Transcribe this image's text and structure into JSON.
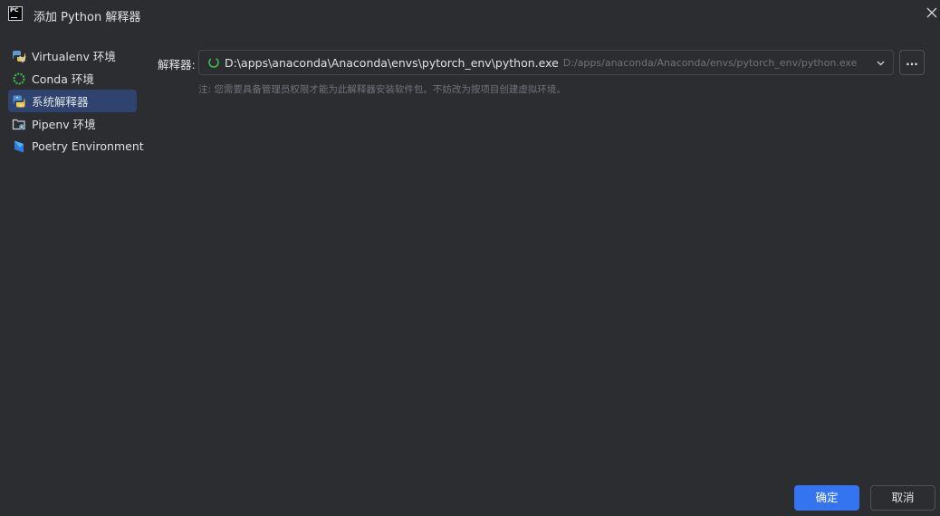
{
  "window": {
    "title": "添加 Python 解释器",
    "icon": "pycharm-icon",
    "app_icon_text": "PC"
  },
  "sidebar": {
    "items": [
      {
        "label": "Virtualenv 环境",
        "icon": "virtualenv-icon",
        "selected": false
      },
      {
        "label": "Conda 环境",
        "icon": "conda-icon",
        "selected": false
      },
      {
        "label": "系统解释器",
        "icon": "python-icon",
        "selected": true
      },
      {
        "label": "Pipenv 环境",
        "icon": "pipenv-icon",
        "selected": false
      },
      {
        "label": "Poetry Environment",
        "icon": "poetry-icon",
        "selected": false
      }
    ]
  },
  "interpreter": {
    "label": "解释器:",
    "value": "D:\\apps\\anaconda\\Anaconda\\envs\\pytorch_env\\python.exe",
    "secondary_path": "D:/apps/anaconda/Anaconda/envs/pytorch_env/python.exe",
    "browse_label": "...",
    "note": "注: 您需要具备管理员权限才能为此解释器安装软件包。不妨改为按项目创建虚拟环境。"
  },
  "footer": {
    "ok_label": "确定",
    "cancel_label": "取消"
  },
  "colors": {
    "background": "#2b2d30",
    "selection": "#2e436e",
    "primary_button": "#3574f0",
    "muted_text": "#6f737a"
  }
}
